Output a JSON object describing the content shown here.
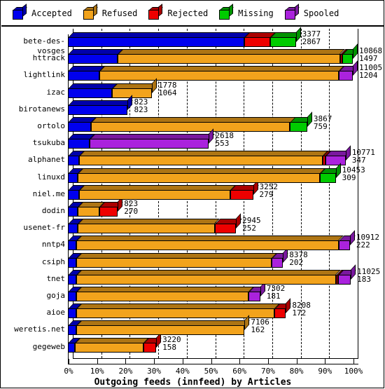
{
  "legend": {
    "items": [
      {
        "label": "Accepted",
        "color": "#0000ee",
        "icon": "cube-icon"
      },
      {
        "label": "Refused",
        "color": "#f2a31c",
        "icon": "cube-icon"
      },
      {
        "label": "Rejected",
        "color": "#ee0000",
        "icon": "cube-icon"
      },
      {
        "label": "Missing",
        "color": "#00cc00",
        "icon": "cube-icon"
      },
      {
        "label": "Spooled",
        "color": "#aa22dd",
        "icon": "cube-icon"
      }
    ]
  },
  "chart_data": {
    "type": "bar",
    "orientation": "horizontal",
    "stacked": true,
    "normalized": true,
    "title": "Outgoing feeds (innfeed) by Articles",
    "xlabel": "Outgoing feeds (innfeed) by Articles",
    "ylabel": "",
    "xlim": [
      0,
      100
    ],
    "xticks": [
      "0%",
      "10%",
      "20%",
      "30%",
      "40%",
      "50%",
      "60%",
      "70%",
      "80%",
      "90%",
      "100%"
    ],
    "grid": true,
    "legend_position": "top",
    "series_names": [
      "Accepted",
      "Refused",
      "Rejected",
      "Missing",
      "Spooled"
    ],
    "categories": [
      "bete-des-vosges",
      "httrack",
      "lightlink",
      "izac",
      "birotanews",
      "ortolo",
      "tsukuba",
      "alphanet",
      "linuxd",
      "niel.me",
      "dodin",
      "usenet-fr",
      "nntp4",
      "csiph",
      "tnet",
      "goja",
      "aioe",
      "weretis.net",
      "gegeweb"
    ],
    "value_labels_top": [
      "3377",
      "10868",
      "11005",
      "1778",
      "823",
      "3867",
      "2618",
      "10771",
      "10453",
      "3252",
      "823",
      "2945",
      "10912",
      "8378",
      "11025",
      "7302",
      "8208",
      "7106",
      "3220"
    ],
    "value_labels_bottom": [
      "2867",
      "1497",
      "1204",
      "1064",
      "823",
      "759",
      "553",
      "347",
      "309",
      "279",
      "270",
      "252",
      "222",
      "202",
      "183",
      "181",
      "172",
      "162",
      "158"
    ],
    "rows": [
      {
        "category": "bete-des-vosges",
        "total": "3377",
        "second": "2867",
        "segments": [
          {
            "name": "Accepted",
            "pct": 62.0
          },
          {
            "name": "Rejected",
            "pct": 9.0
          },
          {
            "name": "Missing",
            "pct": 9.0
          }
        ]
      },
      {
        "category": "httrack",
        "total": "10868",
        "second": "1497",
        "segments": [
          {
            "name": "Accepted",
            "pct": 17.5
          },
          {
            "name": "Refused",
            "pct": 78.0
          },
          {
            "name": "Rejected",
            "pct": 0.8
          },
          {
            "name": "Missing",
            "pct": 3.7
          }
        ]
      },
      {
        "category": "lightlink",
        "total": "11005",
        "second": "1204",
        "segments": [
          {
            "name": "Accepted",
            "pct": 11.0
          },
          {
            "name": "Refused",
            "pct": 84.0
          },
          {
            "name": "Spooled",
            "pct": 5.0
          }
        ]
      },
      {
        "category": "izac",
        "total": "1778",
        "second": "1064",
        "segments": [
          {
            "name": "Accepted",
            "pct": 15.5
          },
          {
            "name": "Refused",
            "pct": 14.0
          }
        ]
      },
      {
        "category": "birotanews",
        "total": "823",
        "second": "823",
        "segments": [
          {
            "name": "Accepted",
            "pct": 21.0
          }
        ]
      },
      {
        "category": "ortolo",
        "total": "3867",
        "second": "759",
        "segments": [
          {
            "name": "Accepted",
            "pct": 8.0
          },
          {
            "name": "Refused",
            "pct": 70.0
          },
          {
            "name": "Missing",
            "pct": 6.0
          }
        ]
      },
      {
        "category": "tsukuba",
        "total": "2618",
        "second": "553",
        "segments": [
          {
            "name": "Accepted",
            "pct": 7.5
          },
          {
            "name": "Spooled",
            "pct": 42.0
          }
        ]
      },
      {
        "category": "alphanet",
        "total": "10771",
        "second": "347",
        "segments": [
          {
            "name": "Accepted",
            "pct": 4.0
          },
          {
            "name": "Refused",
            "pct": 85.5
          },
          {
            "name": "Rejected",
            "pct": 1.0
          },
          {
            "name": "Spooled",
            "pct": 7.0
          }
        ]
      },
      {
        "category": "linuxd",
        "total": "10453",
        "second": "309",
        "segments": [
          {
            "name": "Accepted",
            "pct": 3.5
          },
          {
            "name": "Refused",
            "pct": 85.0
          },
          {
            "name": "Missing",
            "pct": 5.5
          }
        ]
      },
      {
        "category": "niel.me",
        "total": "3252",
        "second": "279",
        "segments": [
          {
            "name": "Accepted",
            "pct": 4.0
          },
          {
            "name": "Refused",
            "pct": 53.0
          },
          {
            "name": "Rejected",
            "pct": 8.0
          }
        ]
      },
      {
        "category": "dodin",
        "total": "823",
        "second": "270",
        "segments": [
          {
            "name": "Accepted",
            "pct": 3.5
          },
          {
            "name": "Refused",
            "pct": 7.5
          },
          {
            "name": "Rejected",
            "pct": 6.5
          }
        ]
      },
      {
        "category": "usenet-fr",
        "total": "2945",
        "second": "252",
        "segments": [
          {
            "name": "Accepted",
            "pct": 3.5
          },
          {
            "name": "Refused",
            "pct": 48.0
          },
          {
            "name": "Rejected",
            "pct": 7.5
          }
        ]
      },
      {
        "category": "nntp4",
        "total": "10912",
        "second": "222",
        "segments": [
          {
            "name": "Accepted",
            "pct": 3.0
          },
          {
            "name": "Refused",
            "pct": 92.0
          },
          {
            "name": "Spooled",
            "pct": 4.0
          }
        ]
      },
      {
        "category": "csiph",
        "total": "8378",
        "second": "202",
        "segments": [
          {
            "name": "Accepted",
            "pct": 3.0
          },
          {
            "name": "Refused",
            "pct": 68.5
          },
          {
            "name": "Spooled",
            "pct": 4.0
          }
        ]
      },
      {
        "category": "tnet",
        "total": "11025",
        "second": "183",
        "segments": [
          {
            "name": "Accepted",
            "pct": 3.0
          },
          {
            "name": "Refused",
            "pct": 91.0
          },
          {
            "name": "Rejected",
            "pct": 0.8
          },
          {
            "name": "Spooled",
            "pct": 4.5
          }
        ]
      },
      {
        "category": "goja",
        "total": "7302",
        "second": "181",
        "segments": [
          {
            "name": "Accepted",
            "pct": 3.0
          },
          {
            "name": "Refused",
            "pct": 60.5
          },
          {
            "name": "Spooled",
            "pct": 4.0
          }
        ]
      },
      {
        "category": "aioe",
        "total": "8208",
        "second": "172",
        "segments": [
          {
            "name": "Accepted",
            "pct": 3.0
          },
          {
            "name": "Refused",
            "pct": 69.5
          },
          {
            "name": "Rejected",
            "pct": 4.0
          }
        ]
      },
      {
        "category": "weretis.net",
        "total": "7106",
        "second": "162",
        "segments": [
          {
            "name": "Accepted",
            "pct": 3.0
          },
          {
            "name": "Refused",
            "pct": 59.0
          }
        ]
      },
      {
        "category": "gegeweb",
        "total": "3220",
        "second": "158",
        "segments": [
          {
            "name": "Accepted",
            "pct": 2.5
          },
          {
            "name": "Refused",
            "pct": 24.0
          },
          {
            "name": "Rejected",
            "pct": 4.5
          }
        ]
      }
    ]
  }
}
